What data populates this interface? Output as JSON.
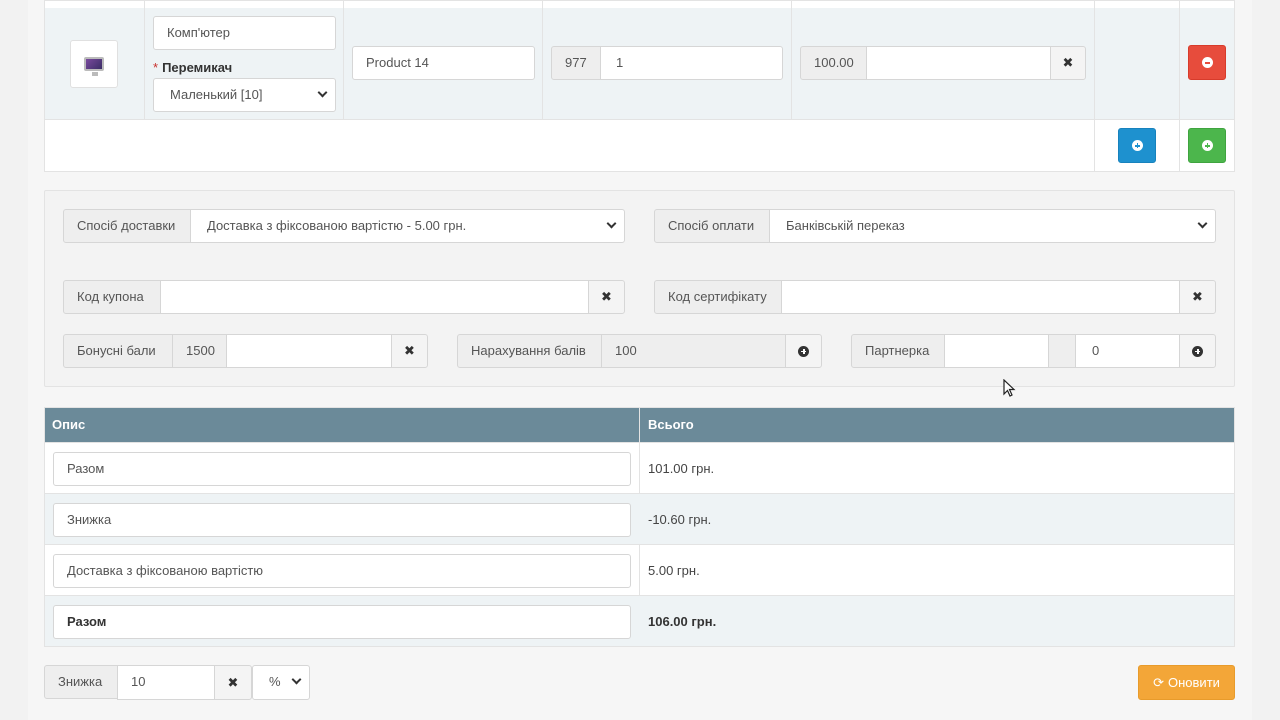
{
  "product_row": {
    "option_name_value": "Комп'ютер",
    "switch_label": "Перемикач",
    "switch_selected": "Маленький [10]",
    "model_value": "Product 14",
    "qty_prefix": "977",
    "qty_value": "1",
    "price_value": "100.00",
    "price_input": ""
  },
  "options": {
    "shipping_label": "Спосіб доставки",
    "shipping_selected": "Доставка з фіксованою вартістю - 5.00 грн.",
    "payment_label": "Спосіб оплати",
    "payment_selected": "Банківській переказ",
    "coupon_label": "Код купона",
    "coupon_value": "",
    "voucher_label": "Код сертифікату",
    "voucher_value": "",
    "reward_label": "Бонусні бали",
    "reward_available": "1500",
    "reward_value": "",
    "points_label": "Нарахування балів",
    "points_value": "100",
    "affiliate_label": "Партнерка",
    "affiliate_value": "",
    "affiliate_commission": "0"
  },
  "totals": {
    "head_desc": "Опис",
    "head_total": "Всього",
    "rows": [
      {
        "label": "Разом",
        "value": "101.00 грн."
      },
      {
        "label": "Знижка",
        "value": "-10.60 грн."
      },
      {
        "label": "Доставка з фіксованою вартістю",
        "value": "5.00 грн."
      },
      {
        "label": "Разом",
        "value": "106.00 грн."
      }
    ]
  },
  "discount": {
    "label": "Знижка",
    "value": "10",
    "type_selected": "%",
    "update_label": "Оновити"
  },
  "colors": {
    "danger": "#e74c3c",
    "primary": "#1e91cf",
    "success": "#4cb64c",
    "warning": "#f3a638",
    "table_header": "#6b8a99"
  }
}
